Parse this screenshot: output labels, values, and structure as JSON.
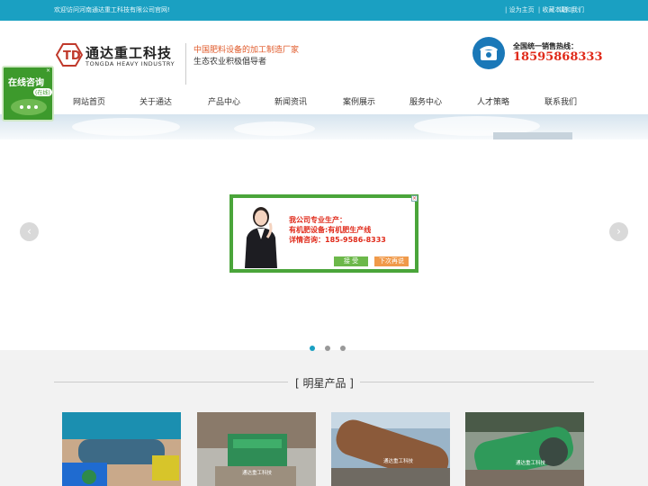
{
  "topbar": {
    "welcome": "欢迎访问河南通达重工科技有限公司官网!",
    "links": [
      "| 设为主页",
      "| 收藏本站",
      "|"
    ],
    "contact": "请和我们"
  },
  "header": {
    "logo_cn": "通达重工科技",
    "logo_en": "TONGDA HEAVY INDUSTRY",
    "slogan_1": "中国肥料设备的加工制造厂家",
    "slogan_2": "生态农业积极倡导者",
    "hotline_label": "全国统一销售热线：",
    "hotline_number": "18595868333",
    "icon": "telephone-icon"
  },
  "nav": {
    "items": [
      "网站首页",
      "关于通达",
      "产品中心",
      "新闻资讯",
      "案例展示",
      "服务中心",
      "人才策略",
      "联系我们"
    ]
  },
  "float_consult": {
    "title": "在线咨询",
    "status": "(在线)"
  },
  "popup": {
    "line_1": "我公司专业生产：",
    "line_2": "有机肥设备:有机肥生产线",
    "line_3": "详情咨询：185-9586-8333",
    "accept": "接 受",
    "later": "下次再说"
  },
  "carousel": {
    "slide_count": 3,
    "active_index": 0
  },
  "section": {
    "title": "[ 明星产品 ]"
  },
  "products": {
    "watermark": "通达重工科技"
  },
  "colors": {
    "brand": "#1aa0c2",
    "hotline": "#e02a1a",
    "accent": "#e05a2a",
    "consult_green": "#3d9a2c"
  }
}
